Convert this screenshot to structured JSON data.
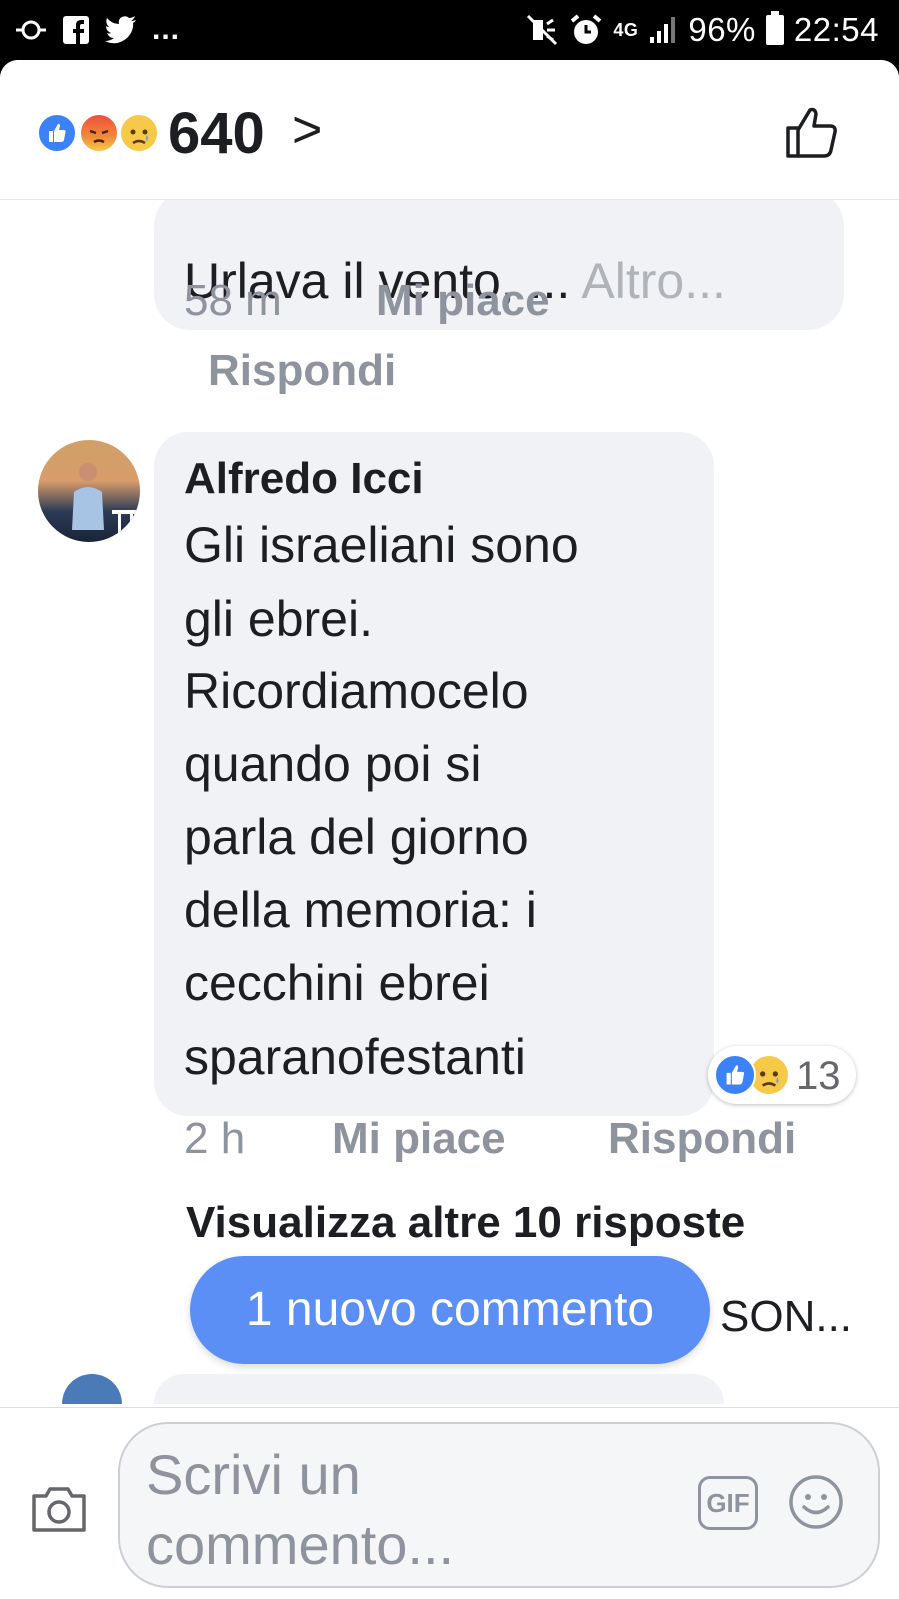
{
  "status_bar": {
    "left_dots": "...",
    "network": "4G",
    "battery": "96%",
    "time": "22:54"
  },
  "header": {
    "reaction_count": "640",
    "chevron": ">"
  },
  "comment_prev": {
    "text": "Urlava il vento, ...",
    "more": "Altro...",
    "time": "58 m",
    "like": "Mi piace",
    "reply": "Rispondi"
  },
  "comment_main": {
    "author": "Alfredo Icci",
    "lines": [
      "Gli israeliani sono",
      "gli ebrei.",
      "Ricordiamocelo",
      "quando poi si",
      "parla del giorno",
      "della memoria: i",
      "cecchini ebrei",
      "sparanofestanti"
    ],
    "reaction_count": "13",
    "time": "2 h",
    "like": "Mi piace",
    "reply": "Rispondi"
  },
  "view_more_replies": "Visualizza altre 10 risposte",
  "partial_text": "SON...",
  "new_comment_pill": "1 nuovo commento",
  "composer": {
    "placeholder_line1": "Scrivi un",
    "placeholder_line2": "commento...",
    "gif_label": "GIF"
  },
  "colors": {
    "like_blue": "#3b82f6",
    "pill_blue": "#5b8ff5",
    "bubble_gray": "#f0f2f5",
    "meta_gray": "#8d949e"
  },
  "icons": [
    "sync-icon",
    "facebook-icon",
    "twitter-icon",
    "mute-icon",
    "alarm-icon",
    "signal-icon",
    "battery-icon",
    "like-reaction-icon",
    "angry-reaction-icon",
    "sad-reaction-icon",
    "chevron-right-icon",
    "thumbs-up-icon",
    "camera-icon",
    "gif-icon",
    "emoji-icon"
  ]
}
